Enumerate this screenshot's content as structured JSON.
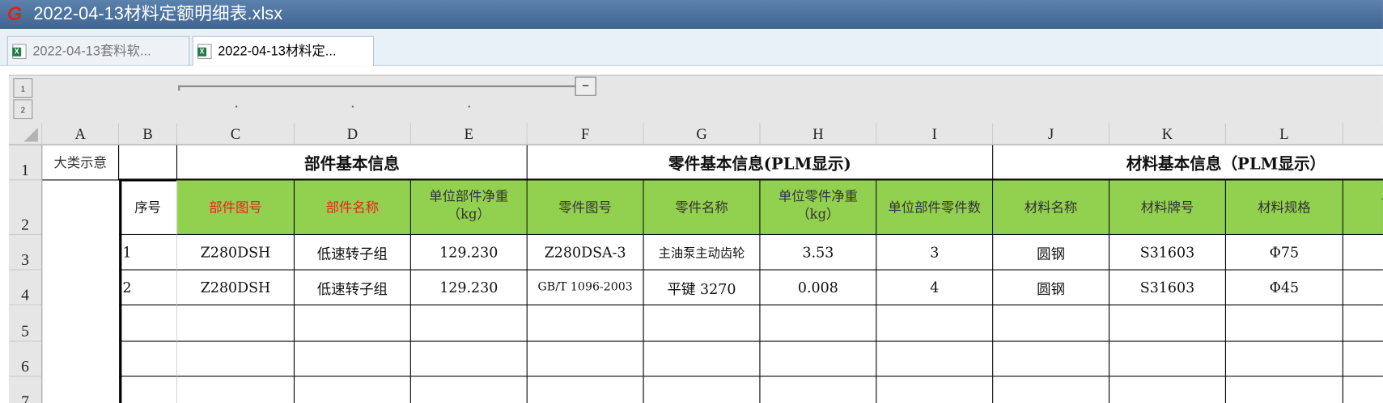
{
  "window": {
    "title": "2022-04-13材料定额明细表.xlsx"
  },
  "tabs": [
    {
      "label": "2022-04-13套料软...",
      "active": false
    },
    {
      "label": "2022-04-13材料定...",
      "active": true
    }
  ],
  "outline": {
    "levels": [
      "1",
      "2"
    ],
    "collapse_label": "−"
  },
  "columns": [
    "A",
    "B",
    "C",
    "D",
    "E",
    "F",
    "G",
    "H",
    "I",
    "J",
    "K",
    "L",
    ""
  ],
  "rows": [
    "1",
    "2",
    "3",
    "4",
    "5",
    "6",
    "7"
  ],
  "sheet": {
    "a1": "大类示意",
    "group_titles": [
      "部件基本信息",
      "零件基本信息(PLM显示)",
      "材料基本信息（PLM显示）"
    ],
    "headers": [
      "序号",
      "部件图号",
      "部件名称",
      "单位部件净重（kg）",
      "零件图号",
      "零件名称",
      "单位零件净重（kg）",
      "单位部件零件数",
      "材料名称",
      "材料牌号",
      "材料规格",
      "单位面"
    ],
    "data": [
      [
        "1",
        "Z280DSH",
        "低速转子组",
        "129.230",
        "Z280DSA-3",
        "主油泵主动齿轮",
        "3.53",
        "3",
        "圆钢",
        "S31603",
        "Φ75",
        ""
      ],
      [
        "2",
        "Z280DSH",
        "低速转子组",
        "129.230",
        "GB/T 1096-2003",
        "平键 3270",
        "0.008",
        "4",
        "圆钢",
        "S31603",
        "Φ45",
        ""
      ]
    ]
  },
  "colors": {
    "header_green": "#92D050",
    "red_text": "#E8241C",
    "titlebar": "#4A6D95"
  }
}
